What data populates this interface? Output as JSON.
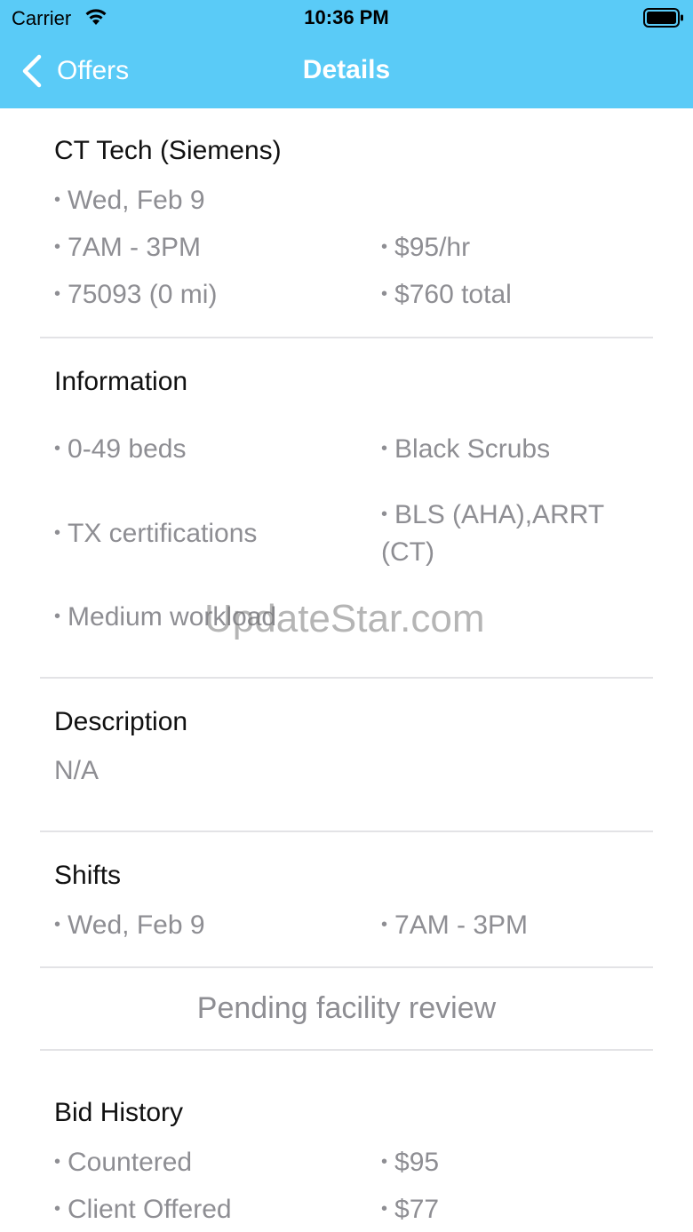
{
  "status_bar": {
    "carrier": "Carrier",
    "time": "10:36 PM"
  },
  "nav": {
    "back_label": "Offers",
    "title": "Details"
  },
  "job": {
    "title": "CT Tech (Siemens)",
    "date": "Wed, Feb 9",
    "hours": "7AM - 3PM",
    "rate": "$95/hr",
    "location": "75093 (0 mi)",
    "total": "$760 total"
  },
  "information": {
    "title": "Information",
    "items": [
      "0-49 beds",
      "Black Scrubs",
      "TX certifications",
      "BLS (AHA),ARRT (CT)",
      "Medium workload"
    ]
  },
  "description": {
    "title": "Description",
    "text": "N/A"
  },
  "shifts": {
    "title": "Shifts",
    "date": "Wed, Feb 9",
    "hours": "7AM - 3PM"
  },
  "status_message": "Pending facility review",
  "bid_history": {
    "title": "Bid History",
    "rows": [
      {
        "label": "Countered",
        "amount": "$95"
      },
      {
        "label": "Client Offered",
        "amount": "$77"
      }
    ]
  },
  "watermark": "UpdateStar.com",
  "colors": {
    "header": "#5acbf7",
    "secondary_text": "#8e8e93",
    "divider": "#e3e3e6"
  }
}
